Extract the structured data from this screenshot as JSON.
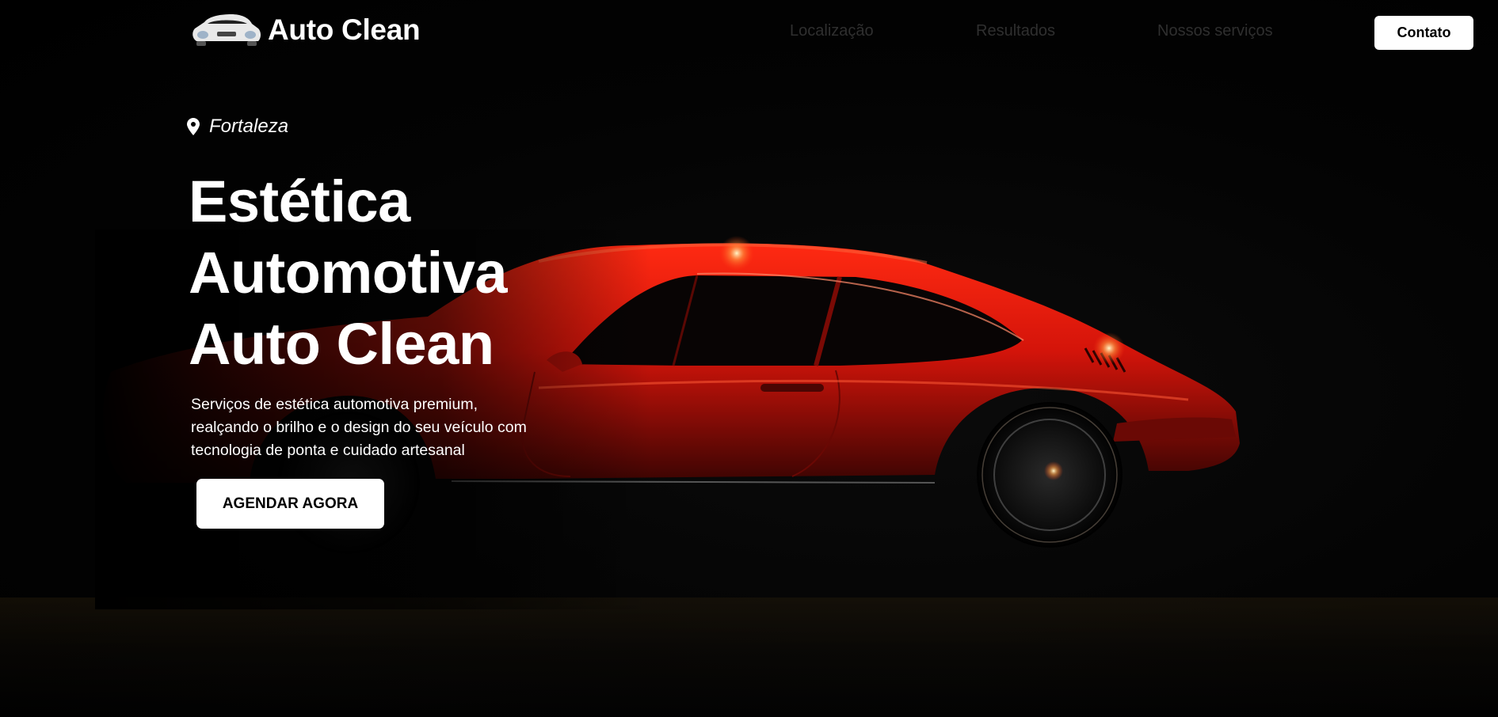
{
  "brand": {
    "name": "Auto Clean",
    "logo_icon": "car-front-icon"
  },
  "nav": {
    "items": [
      {
        "label": "Localização"
      },
      {
        "label": "Resultados"
      },
      {
        "label": "Nossos serviços"
      }
    ],
    "contact_label": "Contato"
  },
  "hero": {
    "location_icon": "map-pin-icon",
    "location": "Fortaleza",
    "title_lines": [
      "Estética",
      "Automotiva",
      "Auto Clean"
    ],
    "description_lines": [
      "Serviços de estética automotiva premium,",
      "realçando o brilho e o design do seu veículo com",
      "tecnologia de ponta e cuidado artesanal"
    ],
    "cta_label": "AGENDAR AGORA",
    "background_image": "red-sports-car-photo"
  },
  "colors": {
    "background": "#000000",
    "text": "#ffffff",
    "nav_text": "#2f2f2f",
    "button_bg": "#ffffff",
    "button_text": "#000000",
    "car_red": "#d9160c"
  }
}
